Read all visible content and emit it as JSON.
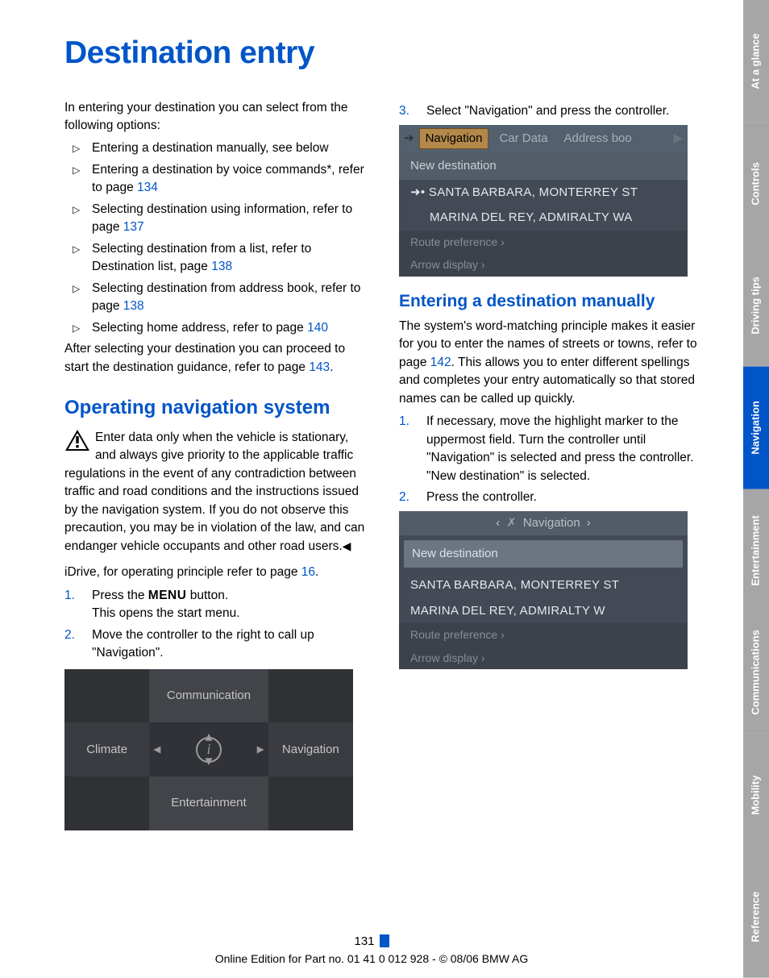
{
  "sidebar": {
    "tabs": [
      "At a glance",
      "Controls",
      "Driving tips",
      "Navigation",
      "Entertainment",
      "Communications",
      "Mobility",
      "Reference"
    ],
    "active_index": 3
  },
  "title": "Destination entry",
  "intro": "In entering your destination you can select from the following options:",
  "options": [
    {
      "text": "Entering a destination manually, see below",
      "ref": null
    },
    {
      "text": "Entering a destination by voice commands*, refer to page ",
      "ref": "134"
    },
    {
      "text": "Selecting destination using information, refer to page ",
      "ref": "137"
    },
    {
      "text": "Selecting destination from a list, refer to Destination list, page ",
      "ref": "138"
    },
    {
      "text": "Selecting destination from address book, refer to page ",
      "ref": "138"
    },
    {
      "text": "Selecting home address, refer to page ",
      "ref": "140"
    }
  ],
  "after_options": {
    "pre": "After selecting your destination you can proceed to start the destination guidance, refer to page ",
    "ref": "143",
    "post": "."
  },
  "h_operating": "Operating navigation system",
  "warning_text": "Enter data only when the vehicle is stationary, and always give priority to the applicable traffic regulations in the event of any contradiction between traffic and road conditions and the instructions issued by the navigation system. If you do not observe this precaution, you may be in violation of the law, and can endanger vehicle occupants and other road users.",
  "idrive": {
    "pre": "iDrive, for operating principle refer to page ",
    "ref": "16",
    "post": "."
  },
  "steps_left": [
    {
      "n": "1.",
      "a": "Press the ",
      "menu": "MENU",
      "b": " button.",
      "c": "This opens the start menu."
    },
    {
      "n": "2.",
      "a": "Move the controller to the right to call up \"Navigation\"."
    }
  ],
  "menu_graphic": {
    "top": "Communication",
    "left": "Climate",
    "right": "Navigation",
    "bottom": "Entertainment"
  },
  "step3": {
    "n": "3.",
    "text": "Select \"Navigation\" and press the controller."
  },
  "screen1": {
    "tabs": {
      "sel": "Navigation",
      "other": "Car Data",
      "other2": "Address boo"
    },
    "new_dest": "New destination",
    "listA": "SANTA BARBARA, MONTERREY ST",
    "listB": "MARINA DEL REY, ADMIRALTY WA",
    "foot1": "Route preference  ›",
    "foot2": "Arrow display  ›"
  },
  "h_manual": "Entering a destination manually",
  "manual_para": {
    "a": "The system's word-matching principle makes it easier for you to enter the names of streets or towns, refer to page ",
    "ref": "142",
    "b": ". This allows you to enter different spellings and completes your entry automatically so that stored names can be called up quickly."
  },
  "steps_right": [
    {
      "n": "1.",
      "a": "If necessary, move the highlight marker to the uppermost field. Turn the controller until \"Navigation\" is selected and press the controller.",
      "b": "\"New destination\" is selected."
    },
    {
      "n": "2.",
      "a": "Press the controller."
    }
  ],
  "screen2": {
    "hdr_left": "‹",
    "hdr_sat": "✗",
    "hdr_title": "Navigation",
    "hdr_right": "›",
    "highlight": "New destination",
    "listA": "SANTA BARBARA, MONTERREY ST",
    "listB": "MARINA DEL REY, ADMIRALTY W",
    "foot1": "Route preference ›",
    "foot2": "Arrow display ›"
  },
  "footer": {
    "page": "131",
    "line": "Online Edition for Part no. 01 41 0 012 928 - © 08/06 BMW AG"
  }
}
